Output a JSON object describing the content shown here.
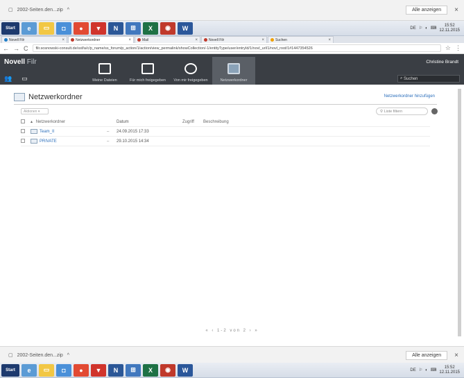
{
  "download_bar": {
    "file_label": "2002-Seiten.den...zip",
    "chevron": "^",
    "show_all": "Alle anzeigen",
    "close": "×"
  },
  "taskbar": {
    "start": "Start",
    "tray_icons": [
      "DE",
      "⚐",
      "◐",
      "⌨"
    ],
    "clock_time": "15:52",
    "clock_date": "12.11.2015"
  },
  "tabs": [
    {
      "label": "Novell Filr",
      "color": "#1e7dc8",
      "active": false
    },
    {
      "label": "Netzwerkordner",
      "color": "#c0392b",
      "active": true
    },
    {
      "label": "Mail",
      "color": "#c0392b",
      "active": false
    },
    {
      "label": "Novell Filr",
      "color": "#c0392b",
      "active": false
    },
    {
      "label": "Suchen",
      "color": "#f0a000",
      "active": false
    }
  ],
  "address": {
    "url": "filr.sosnowski-consult.de/ssf/a/c/p_name/ss_forum/p_action/1/action/view_permalink/showCollection/-1/entityType/user/entryId/1/novl_url/1/novl_root/1#1447354526"
  },
  "app": {
    "brand": "Novell",
    "brand_sub": "Filr",
    "user": "Christine Brandt",
    "nav": [
      {
        "label": "Meine Dateien",
        "active": false
      },
      {
        "label": "Für mich freigegeben",
        "active": false
      },
      {
        "label": "Von mir freigegeben",
        "active": false
      },
      {
        "label": "Netzwerkordner",
        "active": true
      }
    ],
    "search_placeholder": "Suchen"
  },
  "page": {
    "title": "Netzwerkordner",
    "new_link": "Netzwerkordner hinzufügen",
    "action_menu": "Aktionen",
    "filter_placeholder": "Liste filtern",
    "columns": [
      "Netzwerkordner",
      "Datum",
      "Zugriff",
      "Beschreibung"
    ],
    "rows": [
      {
        "name": "Team_II",
        "dash": "–",
        "date": "24.09.2015 17:33"
      },
      {
        "name": "PRIVATE",
        "dash": "–",
        "date": "29.10.2015 14:34"
      }
    ],
    "pager": "«  ‹  1-2 von 2  ›  »"
  }
}
